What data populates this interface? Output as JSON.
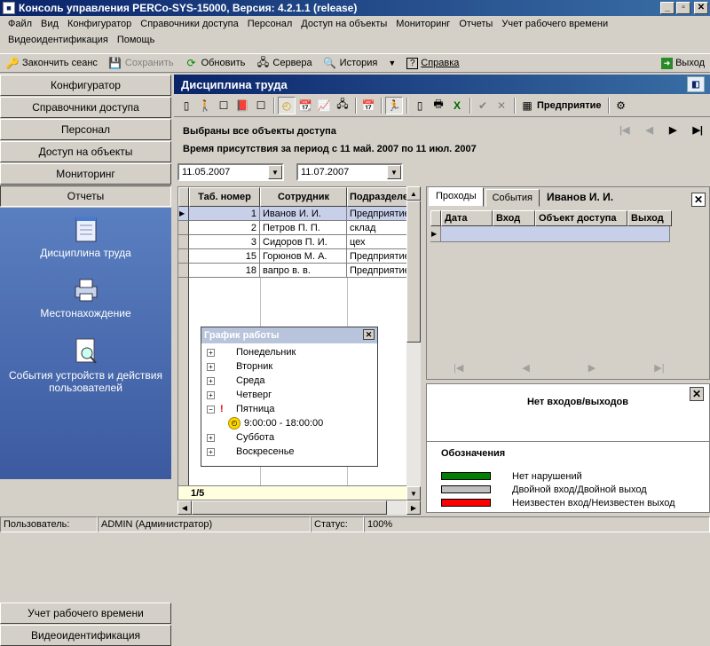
{
  "window": {
    "title": "Консоль управления PERCo-SYS-15000, Версия: 4.2.1.1 (release)"
  },
  "menu": {
    "row1": [
      "Файл",
      "Вид",
      "Конфигуратор",
      "Справочники доступа",
      "Персонал",
      "Доступ на объекты",
      "Мониторинг",
      "Отчеты",
      "Учет рабочего времени"
    ],
    "row2": [
      "Видеоидентификация",
      "Помощь"
    ]
  },
  "toolbar": {
    "end_session": "Закончить сеанс",
    "save": "Сохранить",
    "refresh": "Обновить",
    "servers": "Сервера",
    "history": "История",
    "help": "Справка",
    "exit": "Выход"
  },
  "nav": {
    "top": [
      "Конфигуратор",
      "Справочники доступа",
      "Персонал",
      "Доступ на объекты",
      "Мониторинг",
      "Отчеты"
    ],
    "panel_items": [
      "Дисциплина труда",
      "Местонахождение",
      "События устройств и действия пользователей"
    ],
    "bottom": [
      "Учет рабочего времени",
      "Видеоидентификация"
    ]
  },
  "main": {
    "title": "Дисциплина труда",
    "enterprise_button": "Предприятие",
    "selected_info": "Выбраны все объекты доступа",
    "period_info": "Время присутствия за период с 11 май. 2007  по  11 июл. 2007",
    "date_from": "11.05.2007",
    "date_to": "11.07.2007"
  },
  "grid": {
    "headers": [
      "Таб. номер",
      "Сотрудник",
      "Подразделе"
    ],
    "rows": [
      [
        "1",
        "Иванов И. И.",
        "Предприятие"
      ],
      [
        "2",
        "Петров П. П.",
        "склад"
      ],
      [
        "3",
        "Сидоров П. И.",
        "цех"
      ],
      [
        "15",
        "Горюнов М. А.",
        "Предприятие"
      ],
      [
        "18",
        "вапро в. в.",
        "Предприятие"
      ]
    ],
    "footer": "1/5"
  },
  "schedule": {
    "title": "График работы",
    "days": [
      "Понедельник",
      "Вторник",
      "Среда",
      "Четверг",
      "Пятница",
      "Суббота",
      "Воскресенье"
    ],
    "friday_time": "9:00:00 - 18:00:00"
  },
  "right": {
    "tabs": [
      "Проходы",
      "События"
    ],
    "person": "Иванов И. И.",
    "headers": [
      "Дата",
      "Вход",
      "Объект доступа",
      "Выход"
    ]
  },
  "nopasses": {
    "text": "Нет входов/выходов",
    "legend_title": "Обозначения",
    "legend": [
      {
        "color": "#008000",
        "label": "Нет нарушений"
      },
      {
        "color": "#c0c0c0",
        "label": "Двойной вход/Двойной выход"
      },
      {
        "color": "#ff0000",
        "label": "Неизвестен вход/Неизвестен выход"
      }
    ]
  },
  "status": {
    "user_label": "Пользователь:",
    "user_value": "ADMIN (Администратор)",
    "status_label": "Статус:",
    "status_value": "100%"
  }
}
